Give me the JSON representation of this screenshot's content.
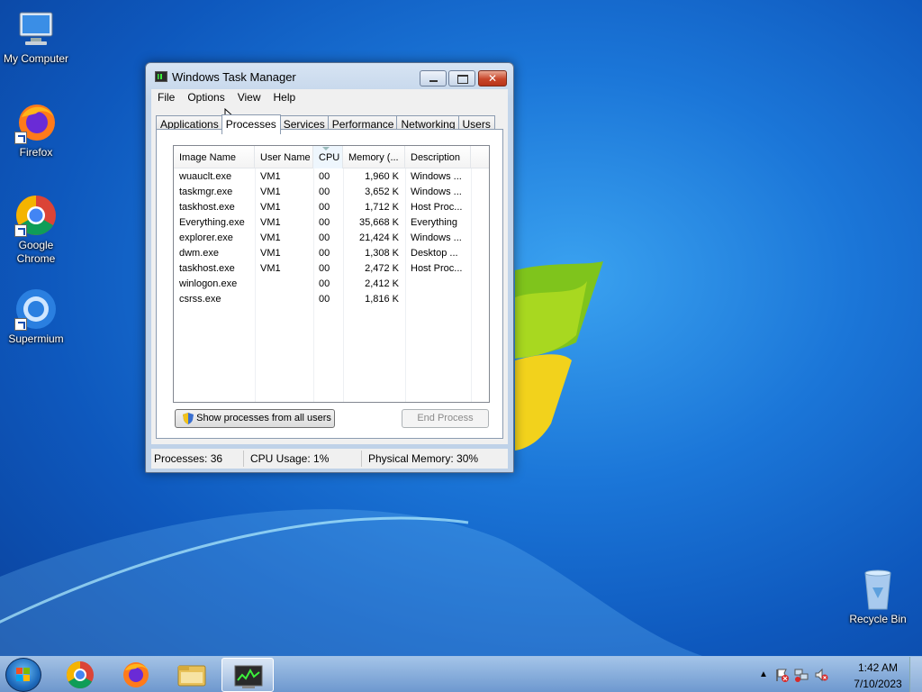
{
  "desktop": {
    "icons": [
      {
        "label": "My Computer"
      },
      {
        "label": "Firefox"
      },
      {
        "label": "Google Chrome"
      },
      {
        "label": "Supermium"
      },
      {
        "label": "Recycle Bin"
      }
    ]
  },
  "window": {
    "title": "Windows Task Manager",
    "menu": [
      "File",
      "Options",
      "View",
      "Help"
    ],
    "tabs": [
      "Applications",
      "Processes",
      "Services",
      "Performance",
      "Networking",
      "Users"
    ],
    "active_tab": "Processes",
    "columns": [
      "Image Name",
      "User Name",
      "CPU",
      "Memory (...",
      "Description"
    ],
    "rows": [
      {
        "image": "wuauclt.exe",
        "user": "VM1",
        "cpu": "00",
        "memory": "1,960 K",
        "desc": "Windows ..."
      },
      {
        "image": "taskmgr.exe",
        "user": "VM1",
        "cpu": "00",
        "memory": "3,652 K",
        "desc": "Windows ..."
      },
      {
        "image": "taskhost.exe",
        "user": "VM1",
        "cpu": "00",
        "memory": "1,712 K",
        "desc": "Host Proc..."
      },
      {
        "image": "Everything.exe",
        "user": "VM1",
        "cpu": "00",
        "memory": "35,668 K",
        "desc": "Everything"
      },
      {
        "image": "explorer.exe",
        "user": "VM1",
        "cpu": "00",
        "memory": "21,424 K",
        "desc": "Windows ..."
      },
      {
        "image": "dwm.exe",
        "user": "VM1",
        "cpu": "00",
        "memory": "1,308 K",
        "desc": "Desktop ..."
      },
      {
        "image": "taskhost.exe",
        "user": "VM1",
        "cpu": "00",
        "memory": "2,472 K",
        "desc": "Host Proc..."
      },
      {
        "image": "winlogon.exe",
        "user": "",
        "cpu": "00",
        "memory": "2,412 K",
        "desc": ""
      },
      {
        "image": "csrss.exe",
        "user": "",
        "cpu": "00",
        "memory": "1,816 K",
        "desc": ""
      }
    ],
    "show_all_button": "Show processes from all users",
    "end_process_button": "End Process",
    "status": {
      "processes": "Processes: 36",
      "cpu": "CPU Usage: 1%",
      "memory": "Physical Memory: 30%"
    }
  },
  "taskbar": {
    "clock_time": "1:42 AM",
    "clock_date": "7/10/2023",
    "apps": [
      "chrome-icon",
      "firefox-icon",
      "file-explorer-icon",
      "task-manager-icon"
    ]
  }
}
